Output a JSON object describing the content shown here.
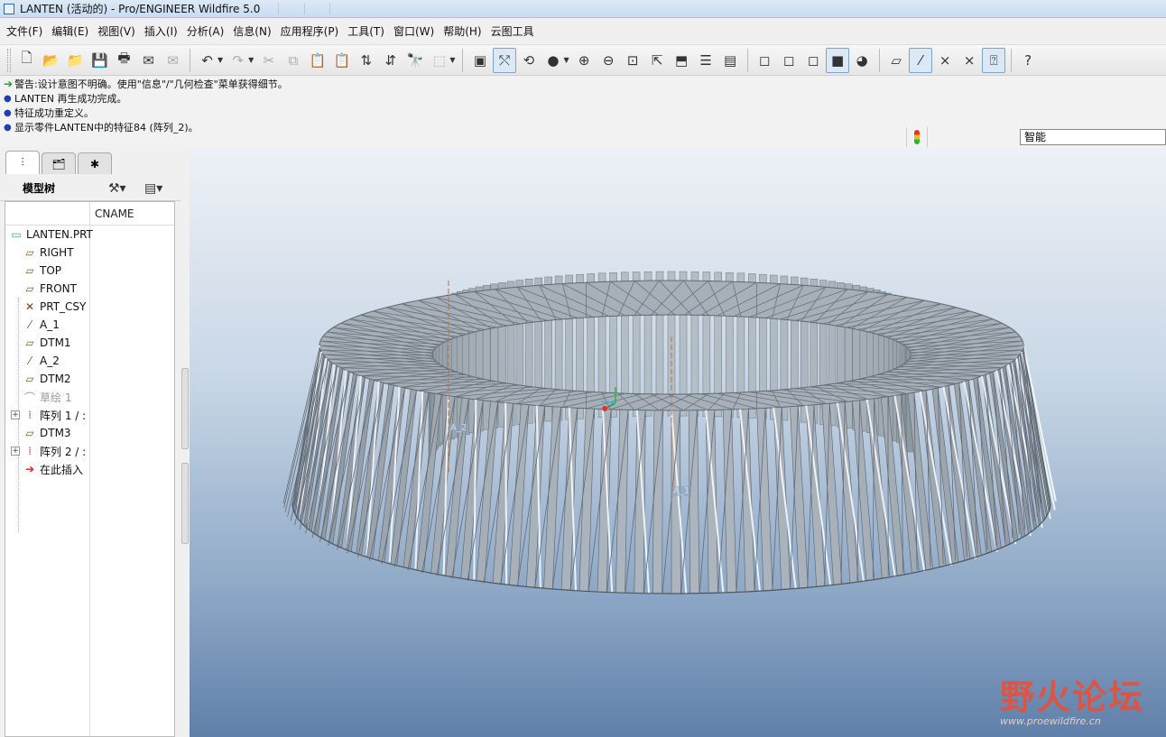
{
  "window": {
    "title": "LANTEN (活动的) - Pro/ENGINEER Wildfire 5.0"
  },
  "menu": [
    "文件(F)",
    "编辑(E)",
    "视图(V)",
    "插入(I)",
    "分析(A)",
    "信息(N)",
    "应用程序(P)",
    "工具(T)",
    "窗口(W)",
    "帮助(H)",
    "云图工具"
  ],
  "messages": [
    {
      "kind": "warning",
      "text": "警告:设计意图不明确。使用\"信息\"/\"几何检查\"菜单获得细节。"
    },
    {
      "kind": "info",
      "text": "LANTEN 再生成功完成。"
    },
    {
      "kind": "info",
      "text": "特征成功重定义。"
    },
    {
      "kind": "info",
      "text": "显示零件LANTEN中的特征84 (阵列_2)。"
    }
  ],
  "filter": {
    "value": "智能"
  },
  "model_tree": {
    "title": "模型树",
    "column": "CNAME",
    "root": "LANTEN.PRT",
    "items": [
      {
        "label": "RIGHT",
        "icon": "datum-plane-icon",
        "dim": false,
        "expand": false
      },
      {
        "label": "TOP",
        "icon": "datum-plane-icon",
        "dim": false,
        "expand": false
      },
      {
        "label": "FRONT",
        "icon": "datum-plane-icon",
        "dim": false,
        "expand": false
      },
      {
        "label": "PRT_CSY",
        "icon": "coordinate-system-icon",
        "dim": false,
        "expand": false
      },
      {
        "label": "A_1",
        "icon": "datum-axis-icon",
        "dim": false,
        "expand": false
      },
      {
        "label": "DTM1",
        "icon": "datum-plane-icon",
        "dim": false,
        "expand": false
      },
      {
        "label": "A_2",
        "icon": "datum-axis-icon",
        "dim": false,
        "expand": false
      },
      {
        "label": "DTM2",
        "icon": "datum-plane-icon",
        "dim": false,
        "expand": false
      },
      {
        "label": "草绘 1",
        "icon": "sketch-icon",
        "dim": true,
        "expand": false
      },
      {
        "label": "阵列 1 / :",
        "icon": "pattern-icon",
        "dim": false,
        "expand": true
      },
      {
        "label": "DTM3",
        "icon": "datum-plane-icon",
        "dim": false,
        "expand": false
      },
      {
        "label": "阵列 2 / :",
        "icon": "pattern-icon",
        "dim": false,
        "expand": true
      },
      {
        "label": "在此插入",
        "icon": "insert-here-arrow-icon",
        "dim": false,
        "expand": false
      }
    ]
  },
  "viewport": {
    "datum_labels": [
      "A_2",
      "A_1"
    ],
    "model_color": "#9aa4ae"
  },
  "watermark": {
    "main": "野火论坛",
    "url": "www.proewildfire.cn"
  },
  "colors": {
    "accent": "#1e9a2d",
    "bullet": "#1d3fb0",
    "watermark": "#e8503a"
  }
}
